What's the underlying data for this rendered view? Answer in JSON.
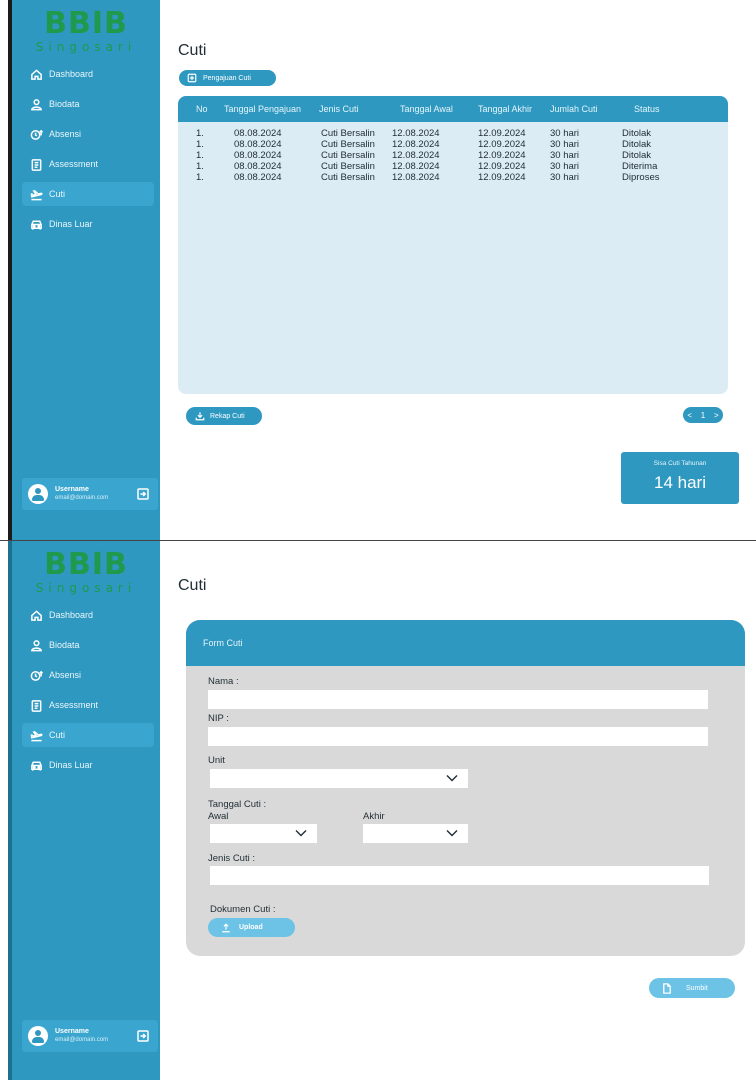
{
  "brand": {
    "name": "BBIB",
    "subtitle": "Singosari",
    "color": "#1f9a4c"
  },
  "theme": {
    "accent": "#2e98c0",
    "panel": "#dcecf4",
    "form_bg": "#d9d9d9",
    "button_light": "#6cc3e6"
  },
  "sidebar": {
    "items": [
      {
        "label": "Dashboard",
        "icon": "home-icon"
      },
      {
        "label": "Biodata",
        "icon": "user-icon"
      },
      {
        "label": "Absensi",
        "icon": "clock-icon"
      },
      {
        "label": "Assessment",
        "icon": "clipboard-icon"
      },
      {
        "label": "Cuti",
        "icon": "plane-icon",
        "active": true
      },
      {
        "label": "Dinas Luar",
        "icon": "car-icon"
      }
    ],
    "user": {
      "name": "Username",
      "email": "email@domain.com"
    }
  },
  "list_page": {
    "title": "Cuti",
    "add_button": "Pengajuan Cuti",
    "table": {
      "headers": [
        "No",
        "Tanggal Pengajuan",
        "Jenis Cuti",
        "Tanggal Awal",
        "Tanggal Akhir",
        "Jumlah Cuti",
        "Status"
      ],
      "rows": [
        [
          "1.",
          "08.08.2024",
          "Cuti Bersalin",
          "12.08.2024",
          "12.09.2024",
          "30 hari",
          "Ditolak"
        ],
        [
          "1.",
          "08.08.2024",
          "Cuti Bersalin",
          "12.08.2024",
          "12.09.2024",
          "30 hari",
          "Ditolak"
        ],
        [
          "1.",
          "08.08.2024",
          "Cuti Bersalin",
          "12.08.2024",
          "12.09.2024",
          "30 hari",
          "Ditolak"
        ],
        [
          "1.",
          "08.08.2024",
          "Cuti Bersalin",
          "12.08.2024",
          "12.09.2024",
          "30 hari",
          "Diterima"
        ],
        [
          "1.",
          "08.08.2024",
          "Cuti Bersalin",
          "12.08.2024",
          "12.09.2024",
          "30 hari",
          "Diproses"
        ]
      ]
    },
    "rekap_button": "Rekap Cuti",
    "pager": {
      "prev": "<",
      "page": "1",
      "next": ">"
    },
    "sisa": {
      "label": "Sisa Cuti Tahunan",
      "value": "14 hari"
    }
  },
  "form_page": {
    "title": "Cuti",
    "form_title": "Form Cuti",
    "fields": {
      "nama": "Nama :",
      "nip": "NIP :",
      "unit": "Unit",
      "tanggal_cuti": "Tanggal Cuti :",
      "awal": "Awal",
      "akhir": "Akhir",
      "jenis_cuti": "Jenis Cuti :",
      "dokumen": "Dokumen Cuti :"
    },
    "upload_button": "Upload",
    "submit_button": "Sumbit"
  }
}
